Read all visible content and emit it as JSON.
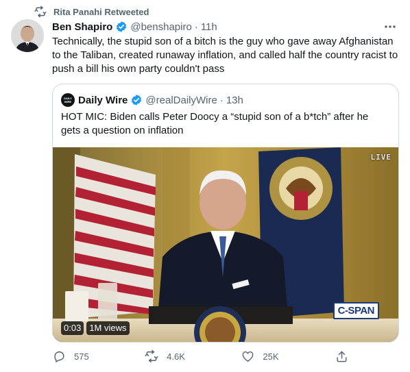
{
  "retweet": {
    "text": "Rita Panahi Retweeted",
    "icon": "retweet-icon"
  },
  "tweet": {
    "author_name": "Ben Shapiro",
    "handle": "@benshapiro",
    "separator": "·",
    "time": "11h",
    "text": "Technically, the stupid son of a bitch is the guy who gave away Afghanistan to the Taliban, created runaway inflation, and called half the country racist to push a bill his own party couldn't pass"
  },
  "quoted": {
    "avatar_text": "DAILY WIRE",
    "author_name": "Daily Wire",
    "handle": "@realDailyWire",
    "separator": "·",
    "time": "13h",
    "text": "HOT MIC: Biden calls Peter Doocy a “stupid son of a b*tch” after he gets a question on inflation",
    "media": {
      "live_tag": "LIVE",
      "network_logo": "C-SPAN",
      "duration": "0:03",
      "views": "1M views"
    }
  },
  "actions": {
    "replies": "575",
    "retweets": "4.6K",
    "likes": "25K"
  },
  "colors": {
    "text_primary": "#0f1419",
    "text_secondary": "#536471",
    "verified_blue": "#1d9bf0",
    "border": "#cfd9de"
  }
}
